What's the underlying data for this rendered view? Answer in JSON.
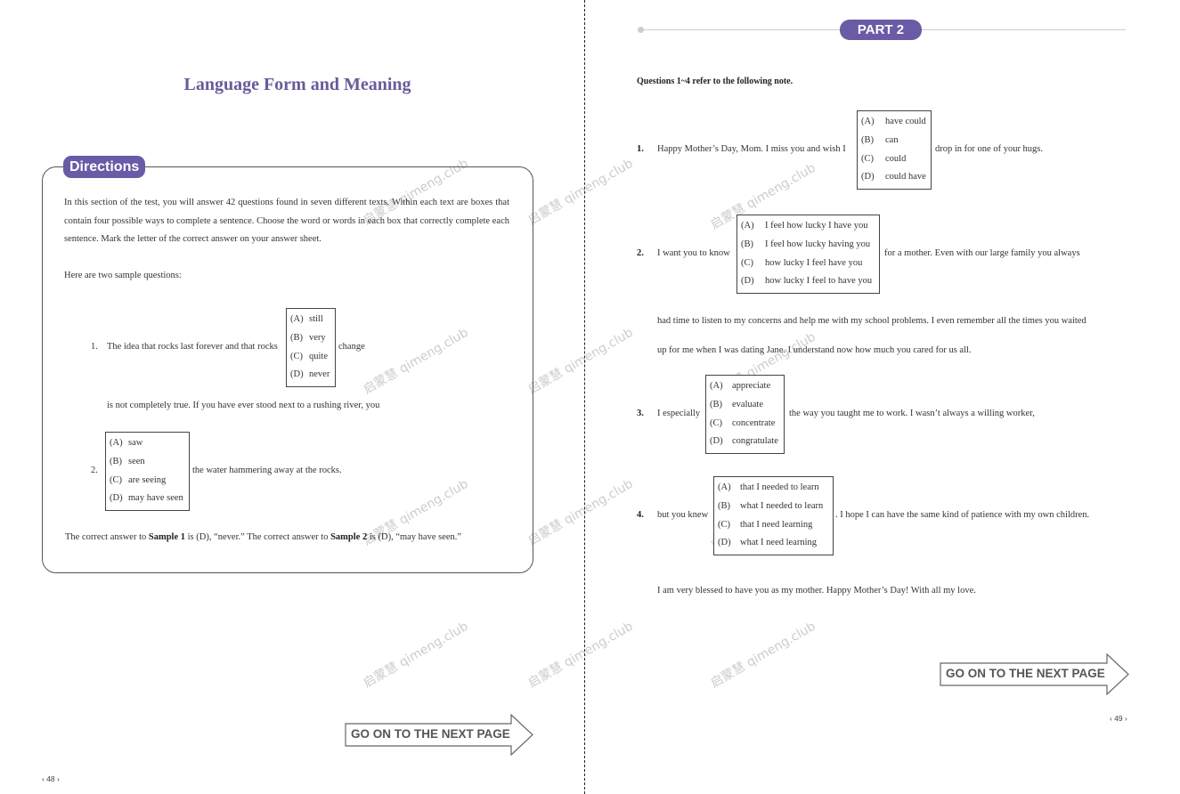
{
  "left_page": {
    "title": "Language Form and Meaning",
    "directions_label": "Directions",
    "intro": "In this section of the test, you will answer 42 questions found in seven different texts. Within each text are boxes that contain four possible ways to complete a sentence. Choose the word or words in each box that correctly complete each sentence. Mark the letter of the correct answer on your answer sheet.",
    "sample_lead": "Here are two sample questions:",
    "samples": [
      {
        "number": "1.",
        "before": "The idea that rocks last forever and that rocks",
        "after": "change",
        "continuation": "is not completely true. If you have ever stood next to a rushing river, you",
        "options": [
          {
            "letter": "(A)",
            "text": "still"
          },
          {
            "letter": "(B)",
            "text": "very"
          },
          {
            "letter": "(C)",
            "text": "quite"
          },
          {
            "letter": "(D)",
            "text": "never"
          }
        ]
      },
      {
        "number": "2.",
        "before": "",
        "after": "the water hammering away at the rocks.",
        "options": [
          {
            "letter": "(A)",
            "text": "saw"
          },
          {
            "letter": "(B)",
            "text": "seen"
          },
          {
            "letter": "(C)",
            "text": "are seeing"
          },
          {
            "letter": "(D)",
            "text": "may have seen"
          }
        ]
      }
    ],
    "answer": {
      "p1": "The correct answer to ",
      "s1": "Sample 1",
      "p2": " is (D), “never.” The correct answer to ",
      "s2": "Sample 2",
      "p3": " is (D), “may have seen.”"
    },
    "next_page_label": "GO ON TO THE NEXT PAGE",
    "page_number": "‹ 48 ›"
  },
  "right_page": {
    "part_label": "PART 2",
    "questions_intro": "Questions 1~4 refer to the following note.",
    "questions": [
      {
        "number": "1.",
        "before": "Happy Mother’s Day, Mom. I miss you and wish I",
        "after": "drop in for one of your hugs.",
        "options": [
          {
            "letter": "(A)",
            "text": "have could"
          },
          {
            "letter": "(B)",
            "text": "can"
          },
          {
            "letter": "(C)",
            "text": "could"
          },
          {
            "letter": "(D)",
            "text": "could have"
          }
        ]
      },
      {
        "number": "2.",
        "before": "I want you to know",
        "after": "for a mother. Even with our large family you always",
        "options": [
          {
            "letter": "(A)",
            "text": "I feel how lucky I have you"
          },
          {
            "letter": "(B)",
            "text": "I feel how lucky having you"
          },
          {
            "letter": "(C)",
            "text": "how lucky I feel have you"
          },
          {
            "letter": "(D)",
            "text": "how lucky I feel to have you"
          }
        ]
      },
      {
        "number": "3.",
        "before": "I especially",
        "after": "the way you taught me to work. I wasn’t always a willing worker,",
        "options": [
          {
            "letter": "(A)",
            "text": "appreciate"
          },
          {
            "letter": "(B)",
            "text": "evaluate"
          },
          {
            "letter": "(C)",
            "text": "concentrate"
          },
          {
            "letter": "(D)",
            "text": "congratulate"
          }
        ]
      },
      {
        "number": "4.",
        "before": "but you knew",
        "after": ". I hope I can have the same kind of patience with my own children.",
        "options": [
          {
            "letter": "(A)",
            "text": "that I needed to learn"
          },
          {
            "letter": "(B)",
            "text": "what I needed to learn"
          },
          {
            "letter": "(C)",
            "text": "that I need learning"
          },
          {
            "letter": "(D)",
            "text": "what I need learning"
          }
        ]
      }
    ],
    "passage_line_1": "had time to listen to my concerns and help me with my school problems. I even remember all the times you waited",
    "passage_line_2": "up for me when I was dating Jane. I understand now how much you cared for us all.",
    "closing": "I am very blessed to have you as my mother. Happy Mother’s Day! With all my love.",
    "next_page_label": "GO ON TO THE NEXT PAGE",
    "page_number": "‹ 49 ›"
  },
  "watermark_text": "启蒙慧  qimeng.club",
  "colors": {
    "accent_purple": "#6b5aa5",
    "title_purple": "#6a5a9a"
  }
}
